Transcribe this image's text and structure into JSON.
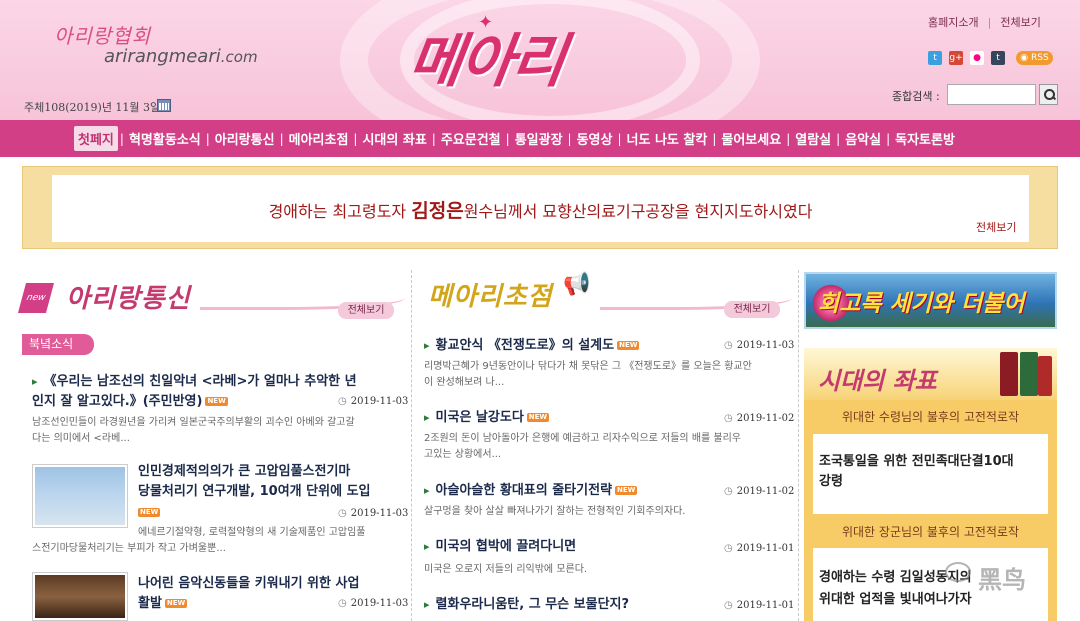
{
  "header": {
    "brand_ko": "아리랑협회",
    "brand_url": "arirangmeari",
    "brand_url_domain": ".com",
    "logo": "메아리",
    "date": "주체108(2019)년 11월 3일",
    "links": [
      "홈페지소개",
      "전체보기"
    ],
    "social": [
      "twitter-icon",
      "googleplus-icon",
      "flickr-icon",
      "tumblr-icon"
    ],
    "rss": "RSS",
    "search_label": "종합검색 :",
    "search_value": ""
  },
  "nav": {
    "items": [
      "첫페지",
      "혁명활동소식",
      "아리랑통신",
      "메아리초점",
      "시대의 좌표",
      "주요문건철",
      "통일광장",
      "동영상",
      "너도 나도 찰칵",
      "물어보세요",
      "열람실",
      "음악실",
      "독자토론방"
    ]
  },
  "banner": {
    "text_pre": "경애하는 최고령도자 ",
    "text_name": "김정은",
    "text_post": "원수님께서 묘향산의료기구공장을 현지지도하시였다",
    "more": "전체보기"
  },
  "left": {
    "title": "아리랑통신",
    "new_tag": "new",
    "more": "전체보기",
    "category": "북녘소식",
    "items": [
      {
        "title_1": "《우리는 남조선의 친일악녀 <라베>가 얼마나 추악한 년",
        "title_2": "인지 잘 알고있다.》(주민반영)",
        "date": "2019-11-03",
        "desc_1": "남조선인민들이 라경원년을 가리켜 일본군국주의부활의 괴수인 아베와 갈고갈",
        "desc_2": "다는 의미에서 <라베..."
      },
      {
        "title_1": "인민경제적의의가 큰 고압임풀스전기마",
        "title_2": "당물처리기 연구개발, 10여개 단위에 도입",
        "date": "2019-11-03",
        "desc_1": "에네르기절약형, 로력절약형의 새 기술제품인 고압임풀",
        "desc_2": "스전기마당물처리기는 부피가 작고 가벼울뿐..."
      },
      {
        "title_1": "나어린 음악신동들을 키워내기 위한 사업",
        "title_2": "활발",
        "date": "2019-11-03"
      }
    ]
  },
  "middle": {
    "title": "메아리초점",
    "more": "전체보기",
    "items": [
      {
        "title": "황교안식 《전쟁도로》의 설계도",
        "date": "2019-11-03",
        "desc_1": "리명박근혜가 9년동안이나 닦다가 채 못닦은 그 《전쟁도로》를 오늘은 황교안",
        "desc_2": "이 완성해보려 나..."
      },
      {
        "title": "미국은 날강도다",
        "date": "2019-11-02",
        "desc_1": "2조원의 돈이 남아돌아가 은행에 예금하고 리자수익으로 저들의 배를 불리우",
        "desc_2": "고있는 상황에서..."
      },
      {
        "title": "아슬아슬한 황대표의 줄타기전략",
        "date": "2019-11-02",
        "desc_1": "살구멍을 찾아 살살 빠져나가기 잘하는 전형적인 기회주의자다.",
        "desc_2": ""
      },
      {
        "title": "미국의 협박에 끌려다니면",
        "date": "2019-11-01",
        "desc_1": "미국은 오로지 저들의 리익밖에 모른다.",
        "desc_2": ""
      },
      {
        "title": "렬화우라니움탄, 그 무슨 보물단지?",
        "date": "2019-11-01",
        "desc_1": "",
        "desc_2": ""
      }
    ]
  },
  "right": {
    "promo": "회고록 세기와 더불어",
    "era_title": "시대의 좌표",
    "sub_1": "위대한 수령님의 불후의 고전적로작",
    "box_1_line_1": "조국통일을 위한 전민족대단결10대",
    "box_1_line_2": "강령",
    "sub_2": "위대한 장군님의 불후의 고전적로작",
    "box_2_line_1": "경애하는 수령 김일성동지의",
    "box_2_line_2": "위대한 업적을 빛내여나가자"
  },
  "watermark": "黑鸟",
  "new_badge": "NEW",
  "colors": {
    "nav": "#d23f86",
    "accent": "#c43a6e",
    "banner_text": "#a01818",
    "era_bg": "#f7cc67"
  }
}
